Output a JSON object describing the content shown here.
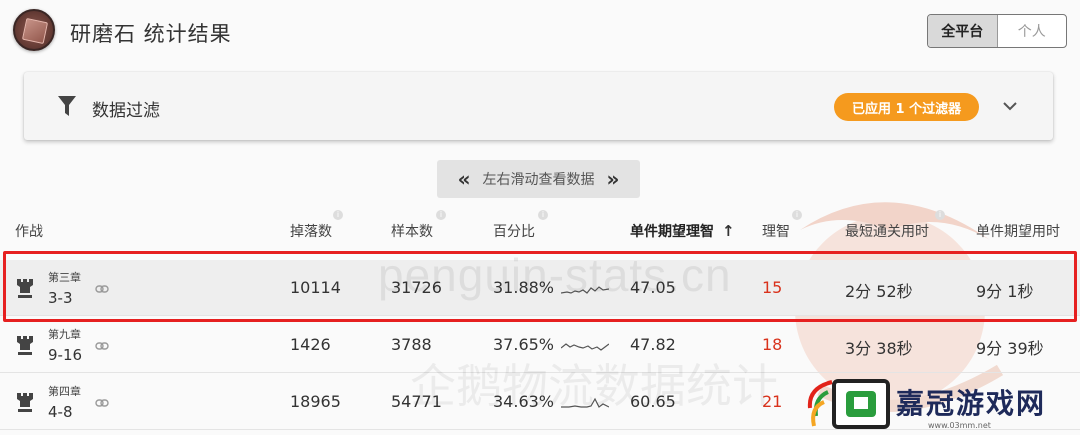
{
  "header": {
    "title": "研磨石 统计结果",
    "toggle": {
      "options": [
        "全平台",
        "个人"
      ],
      "active": "全平台"
    }
  },
  "filter": {
    "label": "数据过滤",
    "badge": "已应用 1 个过滤器"
  },
  "scroll_hint": {
    "left": "«",
    "text": "左右滑动查看数据",
    "right": "»"
  },
  "watermark": {
    "line1": "penguin-stats.cn",
    "line2": "企鹅物流数据统计"
  },
  "table": {
    "columns": [
      "作战",
      "掉落数",
      "样本数",
      "百分比",
      "单件期望理智",
      "理智",
      "最短通关用时",
      "单件期望用时"
    ],
    "sort_indicator": "↑",
    "rows": [
      {
        "chapter": "第三章",
        "stage": "3-3",
        "drops": "10114",
        "samples": "31726",
        "percent": "31.88%",
        "expected_sanity": "47.05",
        "sanity": "15",
        "min_time": "2分 52秒",
        "expected_time": "9分 1秒"
      },
      {
        "chapter": "第九章",
        "stage": "9-16",
        "drops": "1426",
        "samples": "3788",
        "percent": "37.65%",
        "expected_sanity": "47.82",
        "sanity": "18",
        "min_time": "3分 38秒",
        "expected_time": "9分 39秒"
      },
      {
        "chapter": "第四章",
        "stage": "4-8",
        "drops": "18965",
        "samples": "54771",
        "percent": "34.63%",
        "expected_sanity": "60.65",
        "sanity": "21",
        "min_time": "",
        "expected_time": ""
      }
    ]
  },
  "overlay_logo": {
    "text": "嘉冠游戏网",
    "url": "www.03mm.net"
  },
  "colors": {
    "accent": "#f59a1e",
    "sanity_red": "#d9321c",
    "highlight_border": "#e62020"
  }
}
